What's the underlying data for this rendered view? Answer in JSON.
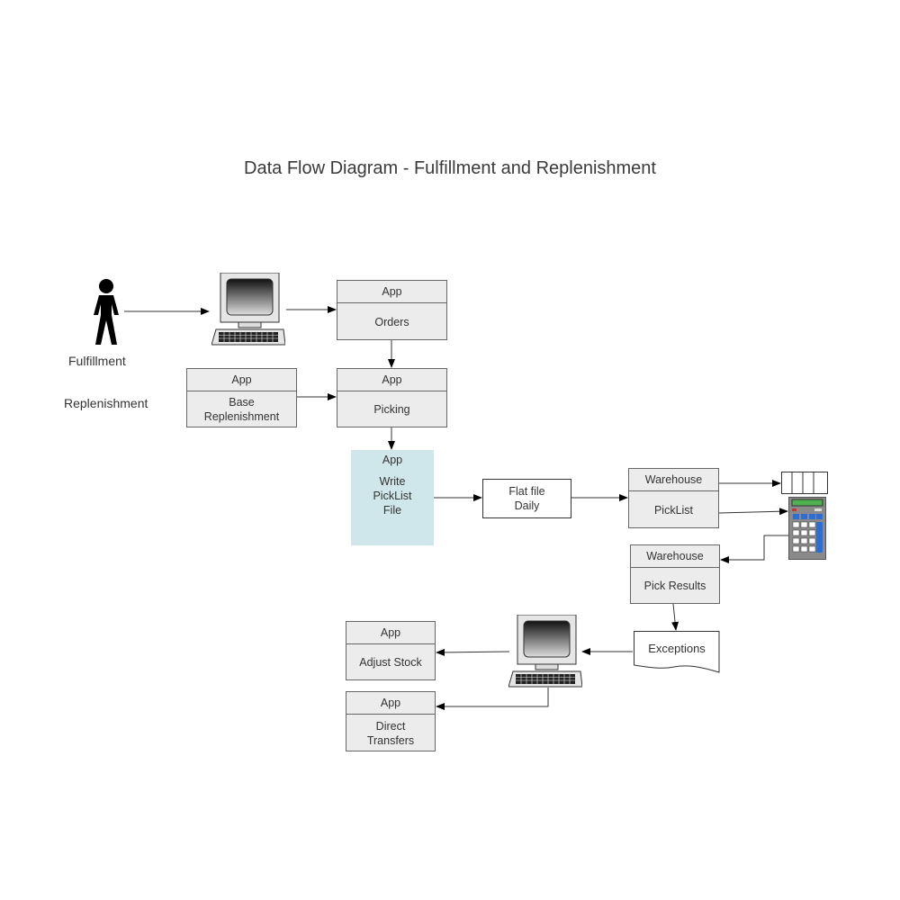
{
  "title": "Data Flow Diagram - Fulfillment and Replenishment",
  "actors": {
    "fulfillment": "Fulfillment",
    "replenishment": "Replenishment"
  },
  "nodes": {
    "orders": {
      "header": "App",
      "body": "Orders"
    },
    "picking": {
      "header": "App",
      "body": "Picking"
    },
    "base_replenishment": {
      "header": "App",
      "body": "Base Replenishment"
    },
    "write_picklist": {
      "header": "App",
      "body": "Write PickList File"
    },
    "flat_file": {
      "body": "Flat file Daily"
    },
    "warehouse_picklist": {
      "header": "Warehouse",
      "body": "PickList"
    },
    "warehouse_pick_results": {
      "header": "Warehouse",
      "body": "Pick Results"
    },
    "exceptions": {
      "body": "Exceptions"
    },
    "adjust_stock": {
      "header": "App",
      "body": "Adjust Stock"
    },
    "direct_transfers": {
      "header": "App",
      "body": "Direct Transfers"
    }
  },
  "icons": {
    "person": "person-icon",
    "computer": "computer-terminal-icon",
    "queue": "queue-icon",
    "handheld": "handheld-scanner-icon",
    "document": "document-icon"
  },
  "colors": {
    "box_fill": "#ececec",
    "highlight_fill": "#cfe6ea",
    "stroke": "#333333"
  }
}
